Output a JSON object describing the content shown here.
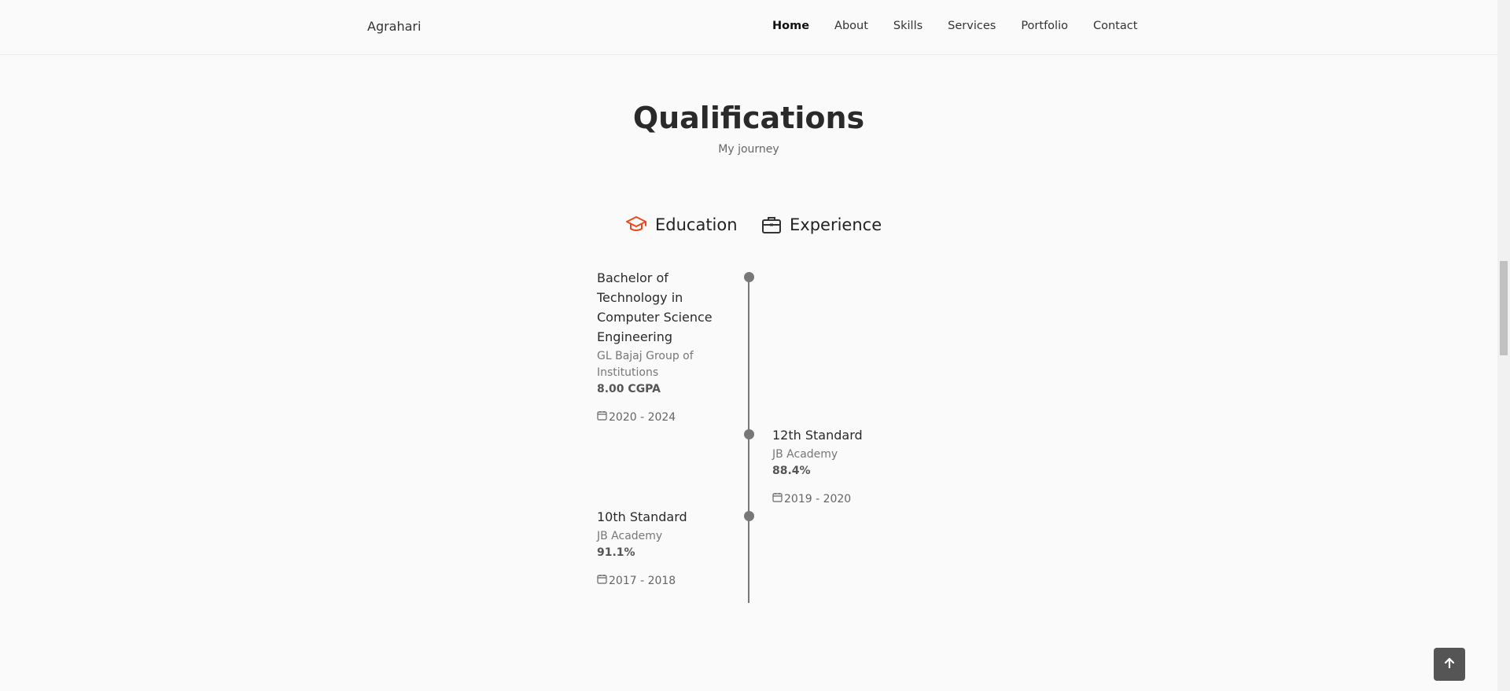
{
  "header": {
    "logo": "Agrahari",
    "nav": [
      "Home",
      "About",
      "Skills",
      "Services",
      "Portfolio",
      "Contact"
    ],
    "active": "Home"
  },
  "section": {
    "title": "Qualifications",
    "subtitle": "My journey"
  },
  "tabs": {
    "education": "Education",
    "experience": "Experience"
  },
  "timeline": [
    {
      "degree": "Bachelor of Technology in Computer Science Engineering",
      "institution": "GL Bajaj Group of Institutions",
      "score": "8.00 CGPA",
      "dates": "2020 - 2024"
    },
    {
      "degree": "12th Standard",
      "institution": "JB Academy",
      "score": "88.4%",
      "dates": "2019 - 2020"
    },
    {
      "degree": "10th Standard",
      "institution": "JB Academy",
      "score": "91.1%",
      "dates": "2017 - 2018"
    }
  ],
  "colors": {
    "accent": "#e8491d",
    "timeline": "#777777"
  },
  "icons": {
    "education": "graduation-cap-icon",
    "experience": "briefcase-icon",
    "date": "calendar-icon",
    "scroll_top": "arrow-up-icon"
  }
}
